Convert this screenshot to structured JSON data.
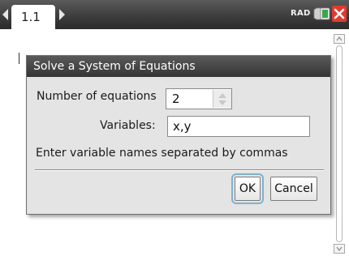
{
  "header": {
    "tab_label": "1.1",
    "angle_mode": "RAD",
    "icons": [
      "tab-left-arrow-icon",
      "tab-right-arrow-icon",
      "battery-icon",
      "close-icon"
    ]
  },
  "dialog": {
    "title": "Solve a System of Equations",
    "num_equations_label": "Number of equations",
    "num_equations_value": "2",
    "variables_label": "Variables:",
    "variables_value": "x,y",
    "hint": "Enter variable names separated by commas",
    "ok_label": "OK",
    "cancel_label": "Cancel"
  },
  "colors": {
    "titlebar": "#3d3d3d",
    "dialog_bg": "#e4e4e4",
    "close_red": "#e23a2f",
    "battery_green": "#3aa64a",
    "focus_ring": "#7fb2cf"
  }
}
